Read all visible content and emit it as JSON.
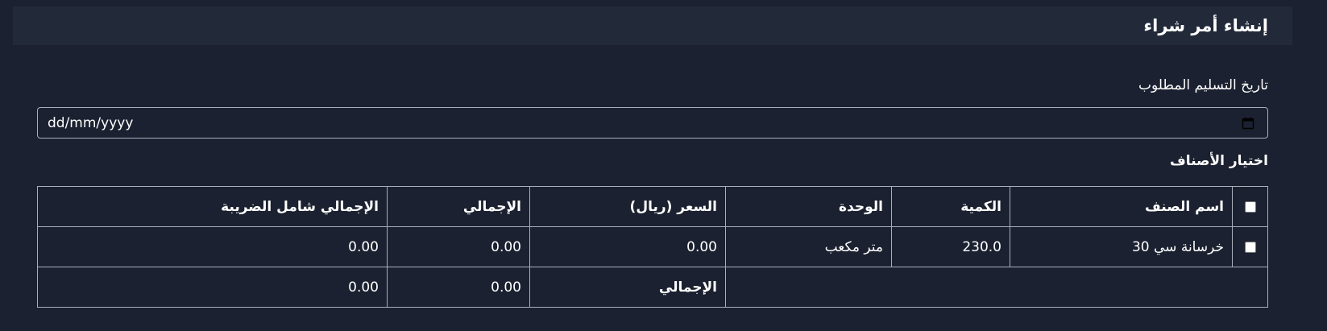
{
  "header": {
    "title": "إنشاء أمر شراء"
  },
  "delivery": {
    "label": "تاريخ التسليم المطلوب",
    "placeholder": "dd/mm/yyyy",
    "icon": "calendar-icon"
  },
  "items_section": {
    "label": "اختيار الأصناف"
  },
  "table": {
    "headers": {
      "name": "اسم الصنف",
      "qty": "الكمية",
      "unit": "الوحدة",
      "price": "السعر (ريال)",
      "total": "الإجمالي",
      "total_tax": "الإجمالي شامل الضريبة"
    },
    "rows": [
      {
        "checked": false,
        "name": "خرسانة سي 30",
        "qty": "230.0",
        "unit": "متر مكعب",
        "price": "0.00",
        "total": "0.00",
        "total_tax": "0.00"
      }
    ],
    "footer": {
      "label": "الإجمالي",
      "total": "0.00",
      "total_tax": "0.00"
    }
  }
}
